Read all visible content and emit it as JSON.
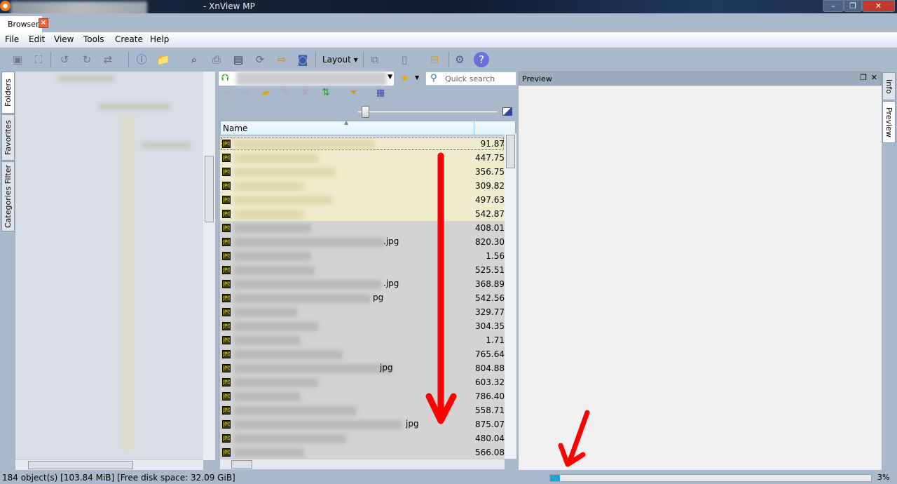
{
  "window": {
    "title": "- XnView MP",
    "controls": [
      "minimize",
      "restore",
      "close"
    ]
  },
  "tabs": [
    {
      "label": "Browser",
      "close": "×"
    }
  ],
  "menu": [
    "File",
    "Edit",
    "View",
    "Tools",
    "Create",
    "Help"
  ],
  "toolbar": {
    "layout_label": "Layout"
  },
  "left_tabs": [
    "Folders",
    "Favorites",
    "Categories Filter"
  ],
  "browser": {
    "search_placeholder": "Quick search",
    "column_name": "Name"
  },
  "files": [
    {
      "ext": "",
      "size": "91.87",
      "selected": true
    },
    {
      "ext": "",
      "size": "447.75",
      "selected": true
    },
    {
      "ext": "",
      "size": "356.75",
      "selected": true
    },
    {
      "ext": "",
      "size": "309.82",
      "selected": true
    },
    {
      "ext": "",
      "size": "497.63",
      "selected": true
    },
    {
      "ext": "",
      "size": "542.87",
      "selected": true
    },
    {
      "ext": "",
      "size": "408.01"
    },
    {
      "ext": ".jpg",
      "size": "820.30"
    },
    {
      "ext": "",
      "size": "1.56"
    },
    {
      "ext": "",
      "size": "525.51"
    },
    {
      "ext": ".jpg",
      "size": "368.89"
    },
    {
      "ext": "pg",
      "size": "542.56"
    },
    {
      "ext": "",
      "size": "329.77"
    },
    {
      "ext": "",
      "size": "304.35"
    },
    {
      "ext": "",
      "size": "1.71"
    },
    {
      "ext": "",
      "size": "765.64"
    },
    {
      "ext": "jpg",
      "size": "804.88"
    },
    {
      "ext": "",
      "size": "603.32"
    },
    {
      "ext": "",
      "size": "786.40"
    },
    {
      "ext": "",
      "size": "558.71"
    },
    {
      "ext": "jpg",
      "size": "875.07"
    },
    {
      "ext": "",
      "size": "480.04"
    },
    {
      "ext": "",
      "size": "566.08"
    }
  ],
  "preview": {
    "title": "Preview"
  },
  "right_tabs": [
    "Info",
    "Preview"
  ],
  "status": {
    "text": "184 object(s) [103.84 MiB] [Free disk space: 32.09 GiB]",
    "progress_percent": 3,
    "progress_label": "3%"
  },
  "colors": {
    "annotation": "#ff0000",
    "progress": "#1ea1dc",
    "selection": "#eeeccc"
  }
}
